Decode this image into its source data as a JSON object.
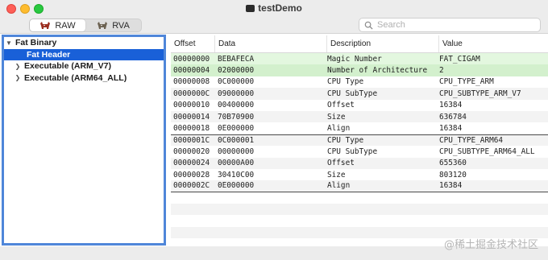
{
  "window": {
    "title": "testDemo",
    "traffic_lights": [
      "close",
      "minimize",
      "zoom"
    ]
  },
  "toolbar": {
    "segments": [
      {
        "label": "RAW",
        "active": true,
        "icon": "bull-icon"
      },
      {
        "label": "RVA",
        "active": false,
        "icon": "bull-icon"
      }
    ],
    "search": {
      "placeholder": "Search",
      "value": ""
    }
  },
  "sidebar": {
    "items": [
      {
        "label": "Fat Binary",
        "expanded": true,
        "level": 0,
        "selected": false
      },
      {
        "label": "Fat Header",
        "level": 1,
        "selected": true,
        "leaf": true
      },
      {
        "label": "Executable  (ARM_V7)",
        "level": 1,
        "expanded": false,
        "selected": false
      },
      {
        "label": "Executable  (ARM64_ALL)",
        "level": 1,
        "expanded": false,
        "selected": false
      }
    ]
  },
  "table": {
    "columns": [
      "Offset",
      "Data",
      "Description",
      "Value"
    ],
    "rows": [
      {
        "offset": "00000000",
        "data": "BEBAFECA",
        "description": "Magic Number",
        "value": "FAT_CIGAM"
      },
      {
        "offset": "00000004",
        "data": "02000000",
        "description": "Number of Architecture",
        "value": "2"
      },
      {
        "offset": "00000008",
        "data": "0C000000",
        "description": "CPU Type",
        "value": "CPU_TYPE_ARM"
      },
      {
        "offset": "0000000C",
        "data": "09000000",
        "description": "CPU SubType",
        "value": "CPU_SUBTYPE_ARM_V7"
      },
      {
        "offset": "00000010",
        "data": "00400000",
        "description": "Offset",
        "value": "16384"
      },
      {
        "offset": "00000014",
        "data": "70B70900",
        "description": "Size",
        "value": "636784"
      },
      {
        "offset": "00000018",
        "data": "0E000000",
        "description": "Align",
        "value": "16384"
      },
      {
        "offset": "0000001C",
        "data": "0C000001",
        "description": "CPU Type",
        "value": "CPU_TYPE_ARM64"
      },
      {
        "offset": "00000020",
        "data": "00000000",
        "description": "CPU SubType",
        "value": "CPU_SUBTYPE_ARM64_ALL"
      },
      {
        "offset": "00000024",
        "data": "00000A00",
        "description": "Offset",
        "value": "655360"
      },
      {
        "offset": "00000028",
        "data": "30410C00",
        "description": "Size",
        "value": "803120"
      },
      {
        "offset": "0000002C",
        "data": "0E000000",
        "description": "Align",
        "value": "16384"
      }
    ]
  },
  "watermark": "@稀土掘金技术社区",
  "colors": {
    "selection": "#1960d8",
    "sidebar_border": "#4f86d9",
    "header_highlight": "#e3f7df",
    "header_highlight_alt": "#d3f0cd"
  }
}
